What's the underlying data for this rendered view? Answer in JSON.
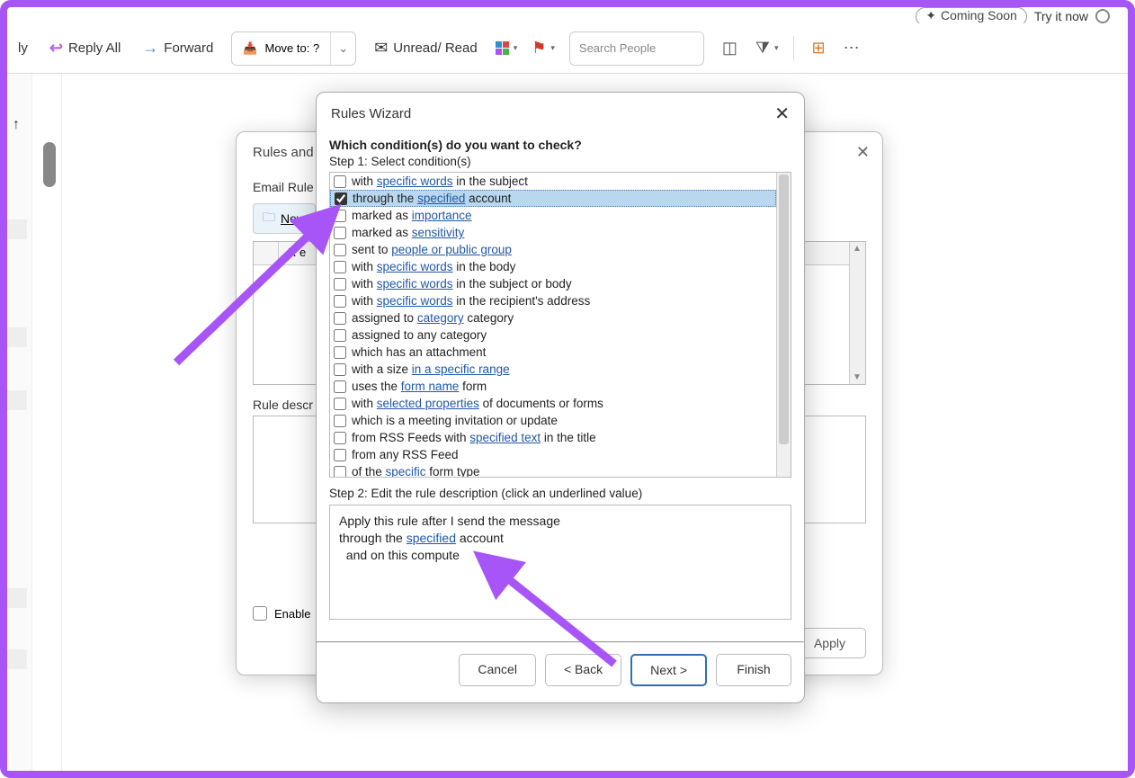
{
  "top_banner": {
    "coming_soon": "Coming Soon",
    "try_it": "Try it now"
  },
  "toolbar": {
    "reply_fragment": "ly",
    "reply_all": "Reply All",
    "forward": "Forward",
    "move_to": "Move to: ?",
    "unread_read": "Unread/ Read",
    "search_placeholder": "Search People"
  },
  "rules_dialog": {
    "title_fragment": "Rules and A",
    "tab": "Email Rule",
    "new_btn": "New",
    "grid_col": "R  e",
    "desc": "Rule descr",
    "enable": "Enable",
    "apply": "Apply"
  },
  "wizard": {
    "title": "Rules Wizard",
    "question": "Which condition(s) do you want to check?",
    "step1": "Step 1: Select condition(s)",
    "step2": "Step 2: Edit the rule description (click an underlined value)",
    "conditions": [
      {
        "checked": false,
        "pre": "with ",
        "link": "specific words",
        "post": " in the subject"
      },
      {
        "checked": true,
        "pre": "through the ",
        "link": "specified",
        "post": " account",
        "selected": true
      },
      {
        "checked": false,
        "pre": "marked as ",
        "link": "importance",
        "post": ""
      },
      {
        "checked": false,
        "pre": "marked as ",
        "link": "sensitivity",
        "post": ""
      },
      {
        "checked": false,
        "pre": "sent to ",
        "link": "people or public group",
        "post": ""
      },
      {
        "checked": false,
        "pre": "with ",
        "link": "specific words",
        "post": " in the body"
      },
      {
        "checked": false,
        "pre": "with ",
        "link": "specific words",
        "post": " in the subject or body"
      },
      {
        "checked": false,
        "pre": "with ",
        "link": "specific words",
        "post": " in the recipient's address"
      },
      {
        "checked": false,
        "pre": "assigned to ",
        "link": "category",
        "post": " category"
      },
      {
        "checked": false,
        "pre": "assigned to any category",
        "link": "",
        "post": ""
      },
      {
        "checked": false,
        "pre": "which has an attachment",
        "link": "",
        "post": ""
      },
      {
        "checked": false,
        "pre": "with a size ",
        "link": "in a specific range",
        "post": ""
      },
      {
        "checked": false,
        "pre": "uses the ",
        "link": "form name",
        "post": " form"
      },
      {
        "checked": false,
        "pre": "with ",
        "link": "selected properties",
        "post": " of documents or forms"
      },
      {
        "checked": false,
        "pre": "which is a meeting invitation or update",
        "link": "",
        "post": ""
      },
      {
        "checked": false,
        "pre": "from RSS Feeds with ",
        "link": "specified text",
        "post": " in the title"
      },
      {
        "checked": false,
        "pre": "from any RSS Feed",
        "link": "",
        "post": ""
      },
      {
        "checked": false,
        "pre": "of the ",
        "link": "specific",
        "post": " form type"
      }
    ],
    "description_lines": {
      "l1": "Apply this rule after I send the message",
      "l2_pre": "through the ",
      "l2_link": "specified",
      "l2_post": " account",
      "l3": "  and on this compute"
    },
    "buttons": {
      "cancel": "Cancel",
      "back": "< Back",
      "next": "Next >",
      "finish": "Finish"
    }
  }
}
